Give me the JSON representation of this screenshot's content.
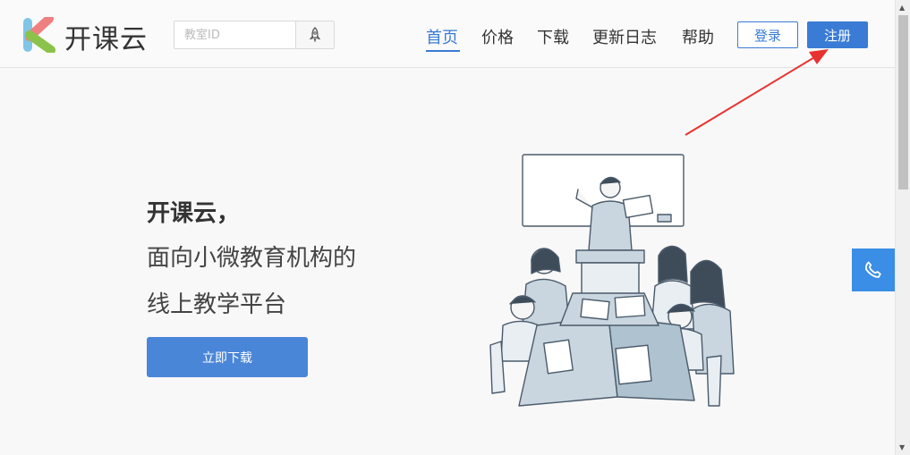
{
  "brand": {
    "name": "开课云"
  },
  "search": {
    "placeholder": "教室ID"
  },
  "nav": {
    "items": [
      {
        "label": "首页",
        "active": true
      },
      {
        "label": "价格"
      },
      {
        "label": "下载"
      },
      {
        "label": "更新日志"
      },
      {
        "label": "帮助"
      }
    ]
  },
  "auth": {
    "login_label": "登录",
    "register_label": "注册"
  },
  "hero": {
    "title": "开课云，",
    "line1": "面向小微教育机构的",
    "line2": "线上教学平台",
    "download_label": "立即下载"
  },
  "colors": {
    "accent": "#3a7bd5",
    "float_button": "#3a8ee6",
    "annotation_arrow": "#e8322f"
  },
  "icons": {
    "search_go": "rocket-icon",
    "float": "phone-icon"
  }
}
